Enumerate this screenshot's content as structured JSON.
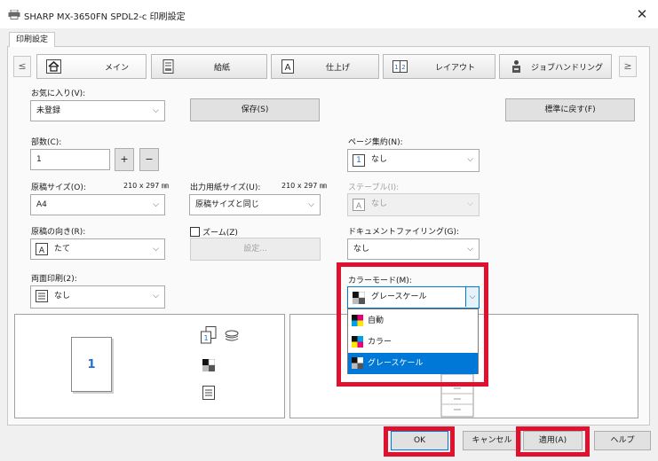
{
  "window": {
    "title": "SHARP MX-3650FN SPDL2-c 印刷設定",
    "close_glyph": "✕"
  },
  "outer_tab": "印刷設定",
  "feature_tabs": {
    "prev_glyph": "≤",
    "next_glyph": "≥",
    "items": [
      {
        "label": "メイン",
        "icon": "home-icon",
        "active": true
      },
      {
        "label": "給紙",
        "icon": "paper-tray-icon"
      },
      {
        "label": "仕上げ",
        "icon": "finishing-icon"
      },
      {
        "label": "レイアウト",
        "icon": "layout-icon"
      },
      {
        "label": "ジョブハンドリング",
        "icon": "job-handling-icon"
      }
    ]
  },
  "favorites": {
    "label": "お気に入り(V):",
    "value": "未登録",
    "save_button": "保存(S)",
    "default_button": "標準に戻す(F)"
  },
  "copies": {
    "label": "部数(C):",
    "value": "1",
    "plus": "+",
    "minus": "−"
  },
  "original_size": {
    "label": "原稿サイズ(O):",
    "dims": "210 x 297 ㎜",
    "value": "A4"
  },
  "output_size": {
    "label": "出力用紙サイズ(U):",
    "dims": "210 x 297 ㎜",
    "value": "原稿サイズと同じ"
  },
  "orientation": {
    "label": "原稿の向き(R):",
    "value": "たて"
  },
  "zoom": {
    "checkbox_label": "ズーム(Z)",
    "checked": false,
    "settings_button": "設定..."
  },
  "duplex": {
    "label": "両面印刷(2):",
    "value": "なし"
  },
  "n_up": {
    "label": "ページ集約(N):",
    "value": "なし",
    "icon_text": "1"
  },
  "staple": {
    "label": "ステープル(I):",
    "value": "なし",
    "disabled": true
  },
  "document_filing": {
    "label": "ドキュメントファイリング(G):",
    "value": "なし"
  },
  "color_mode": {
    "label": "カラーモード(M):",
    "value": "グレースケール",
    "options": [
      {
        "label": "自動",
        "icon": "color-auto-icon"
      },
      {
        "label": "カラー",
        "icon": "color-icon"
      },
      {
        "label": "グレースケール",
        "icon": "grayscale-icon",
        "selected": true
      }
    ]
  },
  "preview": {
    "page_number": "1"
  },
  "footer": {
    "ok": "OK",
    "cancel": "キャンセル",
    "apply": "適用(A)",
    "help": "ヘルプ"
  },
  "colors": {
    "highlight": "#e0102f",
    "selected": "#0078d7",
    "page_number": "#1e6fd0"
  }
}
